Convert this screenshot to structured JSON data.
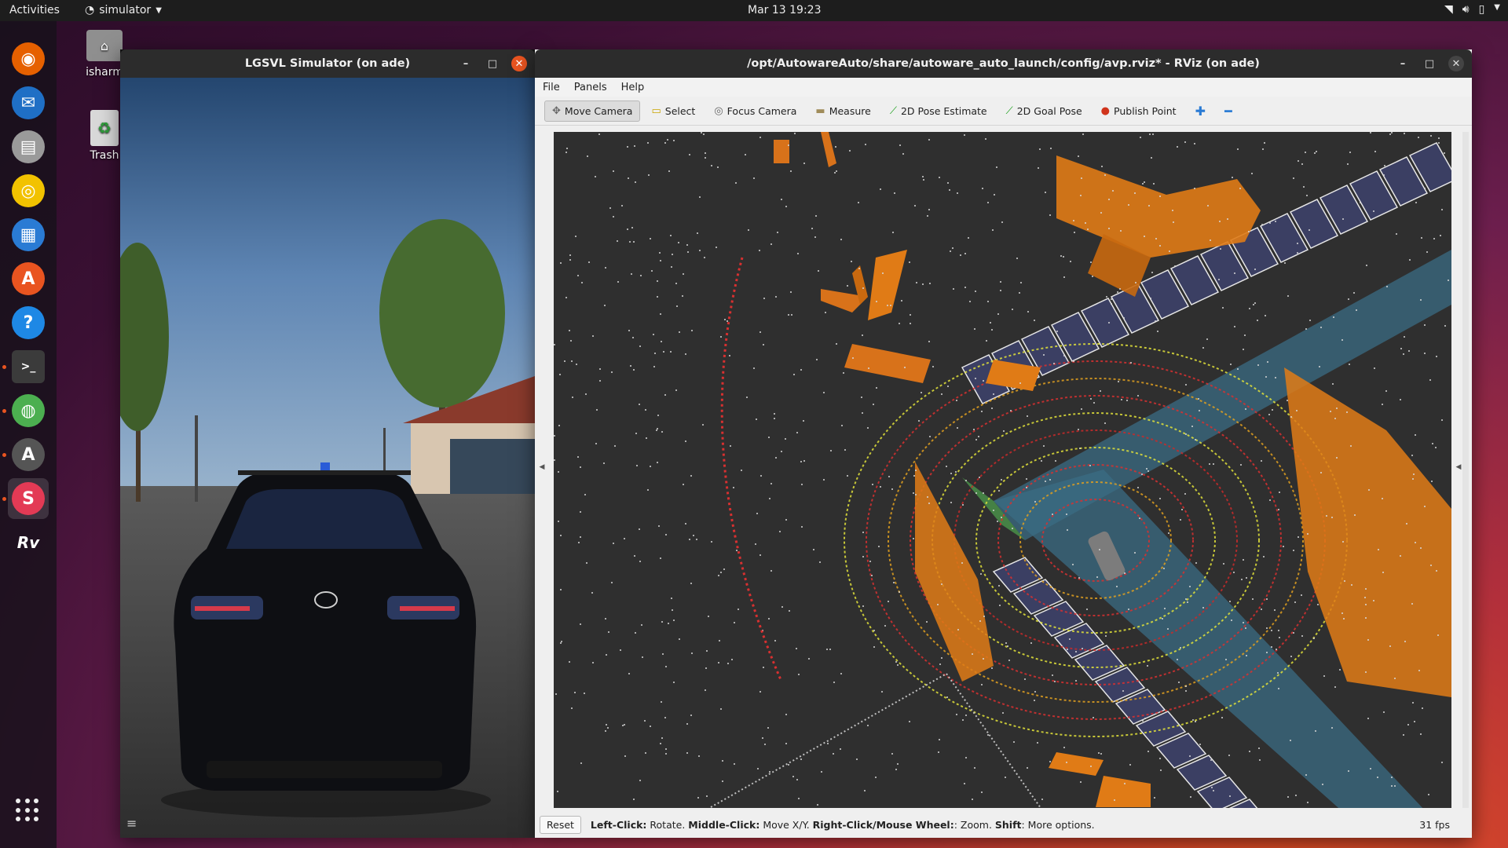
{
  "topbar": {
    "activities": "Activities",
    "app_menu": "simulator",
    "clock": "Mar 13  19:23"
  },
  "desktop": {
    "home_label": "isharm",
    "trash_label": "Trash"
  },
  "dock": [
    {
      "name": "firefox-icon",
      "color": "#e66000"
    },
    {
      "name": "thunderbird-icon",
      "color": "#1f6fc5"
    },
    {
      "name": "files-icon",
      "color": "#9a9a9a"
    },
    {
      "name": "rhythmbox-icon",
      "color": "#f2c200"
    },
    {
      "name": "libreoffice-writer-icon",
      "color": "#2a7bd4"
    },
    {
      "name": "software-center-icon",
      "color": "#e95420"
    },
    {
      "name": "help-icon",
      "color": "#1e88e5"
    },
    {
      "name": "terminal-icon",
      "color": "#3b3b3b"
    },
    {
      "name": "chrome-icon",
      "color": "#4caf50"
    },
    {
      "name": "software-updater-icon",
      "color": "#555555"
    },
    {
      "name": "simulator-icon",
      "color": "#e33a55"
    },
    {
      "name": "rviz-icon",
      "color": "#222222"
    }
  ],
  "lgsvl_window": {
    "title": "LGSVL Simulator (on ade)"
  },
  "rviz_window": {
    "title": "/opt/AutowareAuto/share/autoware_auto_launch/config/avp.rviz* - RViz (on ade)",
    "menu": [
      "File",
      "Panels",
      "Help"
    ],
    "tools": [
      {
        "label": "Move Camera",
        "icon": "✥",
        "active": true,
        "color": "#666666"
      },
      {
        "label": "Select",
        "icon": "▭",
        "active": false,
        "color": "#c9a400"
      },
      {
        "label": "Focus Camera",
        "icon": "◎",
        "active": false,
        "color": "#666666"
      },
      {
        "label": "Measure",
        "icon": "▬",
        "active": false,
        "color": "#a08c5a"
      },
      {
        "label": "2D Pose Estimate",
        "icon": "⟋",
        "active": false,
        "color": "#1aa01a"
      },
      {
        "label": "2D Goal Pose",
        "icon": "⟋",
        "active": false,
        "color": "#1aa01a"
      },
      {
        "label": "Publish Point",
        "icon": "●",
        "active": false,
        "color": "#d0341c"
      }
    ],
    "status": {
      "reset": "Reset",
      "help_parts": [
        {
          "b": "Left-Click:",
          "t": " Rotate. "
        },
        {
          "b": "Middle-Click:",
          "t": " Move X/Y. "
        },
        {
          "b": "Right-Click/Mouse Wheel:",
          "t": ": Zoom. "
        },
        {
          "b": "Shift",
          "t": ": More options."
        }
      ],
      "fps": "31 fps"
    }
  }
}
